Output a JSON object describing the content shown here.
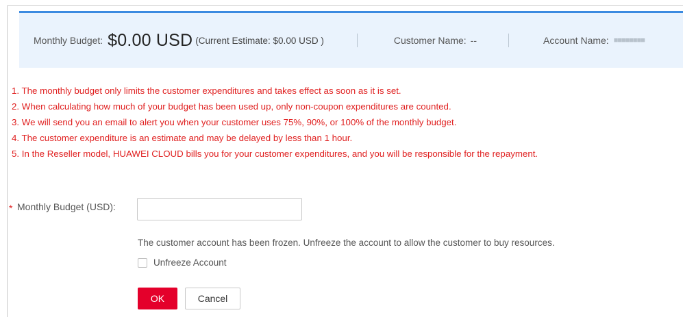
{
  "summary": {
    "budget_label": "Monthly Budget:",
    "budget_value": "$0.00 USD",
    "estimate": "(Current Estimate: $0.00 USD )",
    "customer_label": "Customer Name:",
    "customer_value": "--",
    "account_label": "Account Name:",
    "account_value": "■■■■■■■■"
  },
  "notes": [
    "1. The monthly budget only limits the customer expenditures and takes effect as soon as it is set.",
    "2. When calculating how much of your budget has been used up, only non-coupon expenditures are counted.",
    "3. We will send you an email to alert you when your customer uses 75%, 90%, or 100% of the monthly budget.",
    "4. The customer expenditure is an estimate and may be delayed by less than 1 hour.",
    "5. In the Reseller model, HUAWEI CLOUD bills you for your customer expenditures, and you will be responsible for the repayment."
  ],
  "form": {
    "required_mark": "*",
    "budget_field_label": "Monthly Budget (USD):",
    "budget_field_value": "",
    "frozen_message": "The customer account has been frozen. Unfreeze the account to allow the customer to buy resources.",
    "unfreeze_label": "Unfreeze Account",
    "unfreeze_checked": false
  },
  "buttons": {
    "ok_label": "OK",
    "cancel_label": "Cancel"
  },
  "colors": {
    "accent_blue": "#3b8ae0",
    "summary_bg": "#eaf3fd",
    "note_red": "#e02020",
    "ok_red": "#e4002b"
  }
}
